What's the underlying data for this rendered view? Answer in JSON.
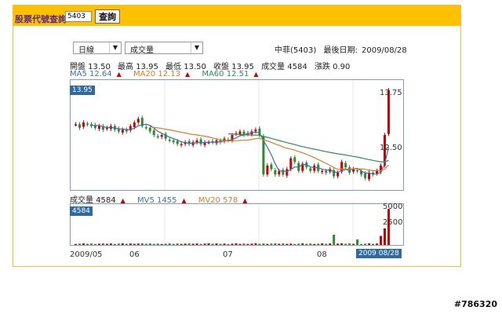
{
  "toolbar": {
    "search_label": "股票代號查詢",
    "input_value": "5403",
    "query_button": "查詢"
  },
  "selects": {
    "period": "日線",
    "indicator": "成交量"
  },
  "header": {
    "stock": "中菲(5403)",
    "last_date_label": "最後日期:",
    "last_date": "2009/08/28"
  },
  "quote": {
    "open_label": "開盤",
    "open": "13.50",
    "high_label": "最高",
    "high": "13.95",
    "low_label": "最低",
    "low": "13.50",
    "close_label": "收盤",
    "close": "13.95",
    "vol_label": "成交量",
    "vol": "4584",
    "chg_label": "漲跌",
    "chg": "0.90"
  },
  "ma": {
    "ma5": "MA5 12.64",
    "ma20": "MA20 12.13",
    "ma60": "MA60 12.51"
  },
  "vol_header": {
    "vol": "成交量 4584",
    "mv5": "MV5 1455",
    "mv20": "MV20 578"
  },
  "price_tag": "13.95",
  "vol_tag": "4584",
  "price_axis": [
    "13.75",
    "12.50"
  ],
  "vol_axis": [
    "5000",
    "2500"
  ],
  "dates": [
    "2009/05",
    "06",
    "07",
    "08"
  ],
  "end_date_tag": "2009 08/28",
  "watermark": "#786320",
  "colors": {
    "up": "#cc0000",
    "down": "#2f8a2f",
    "ma5": "#3a6fb5",
    "ma20": "#e07b20",
    "ma60": "#2e8b57",
    "accent": "#ffc000"
  },
  "chart_data": {
    "type": "candlestick",
    "price_close": [
      13.0,
      12.9,
      13.05,
      13.0,
      12.95,
      12.9,
      12.95,
      12.85,
      12.9,
      12.95,
      12.85,
      12.8,
      12.85,
      12.8,
      12.95,
      13.05,
      13.15,
      12.95,
      12.9,
      12.8,
      12.7,
      12.65,
      12.7,
      12.6,
      12.55,
      12.5,
      12.45,
      12.45,
      12.5,
      12.45,
      12.5,
      12.55,
      12.45,
      12.5,
      12.5,
      12.5,
      12.55,
      12.5,
      12.6,
      12.55,
      12.7,
      12.75,
      12.8,
      12.7,
      12.75,
      12.8,
      12.85,
      12.7,
      11.6,
      11.85,
      11.75,
      11.6,
      11.7,
      11.6,
      11.75,
      12.05,
      11.95,
      11.7,
      11.9,
      11.8,
      11.7,
      11.85,
      11.7,
      11.7,
      11.65,
      11.75,
      11.55,
      11.65,
      11.95,
      11.8,
      11.65,
      11.75,
      11.7,
      11.6,
      11.5,
      11.65,
      11.6,
      11.7,
      11.85,
      12.7,
      13.95
    ],
    "ma_levels": {
      "ma5": 12.64,
      "ma20": 12.13,
      "ma60": 12.51
    },
    "volume_axis": [
      0,
      5000
    ],
    "last_volume": 4584
  }
}
